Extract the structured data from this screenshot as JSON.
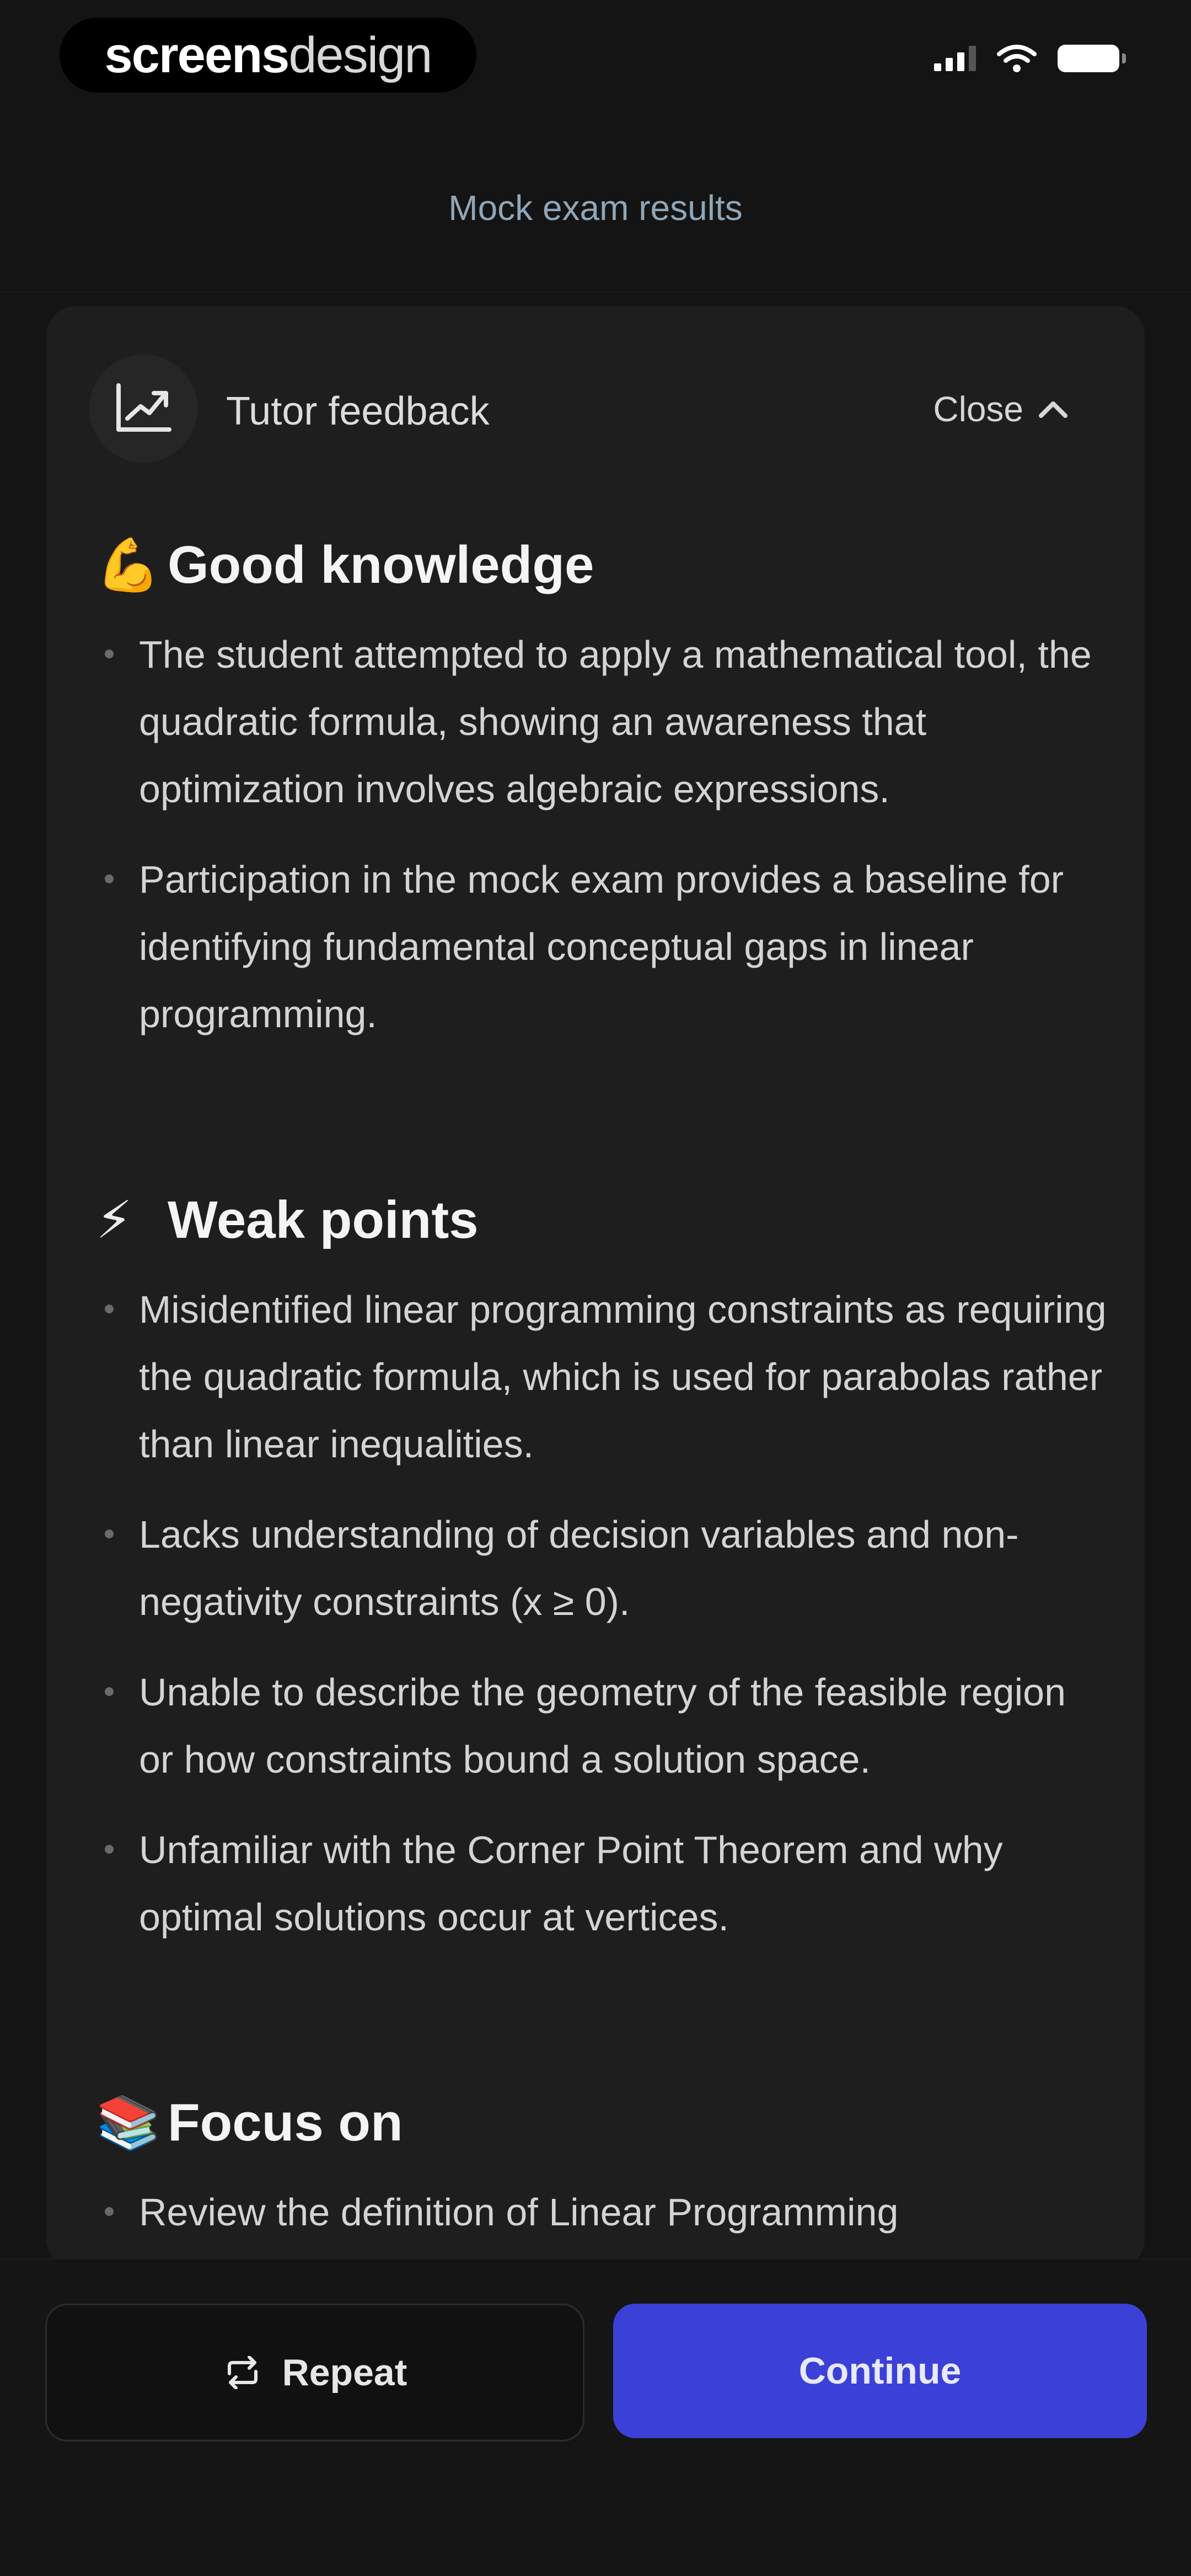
{
  "status_bar": {
    "brand_part1": "screens",
    "brand_part2": "design",
    "icons": [
      "cellular-signal-icon",
      "wifi-icon",
      "battery-icon"
    ]
  },
  "header": {
    "title": "Mock exam results"
  },
  "card": {
    "icon": "chart-icon",
    "title": "Tutor feedback",
    "close_label": "Close",
    "close_icon": "chevron-up-icon"
  },
  "sections": {
    "good": {
      "emoji": "💪",
      "title": "Good knowledge",
      "items": [
        "The student attempted to apply a mathematical tool, the quadratic formula, showing an awareness that optimization involves algebraic expressions.",
        "Participation in the mock exam provides a baseline for identifying fundamental conceptual gaps in linear programming."
      ]
    },
    "weak": {
      "emoji": "⚡",
      "title": "Weak points",
      "items": [
        "Misidentified linear programming constraints as requiring the quadratic formula, which is used for parabolas rather than linear inequalities.",
        "Lacks understanding of decision variables and non-negativity constraints (x ≥ 0).",
        "Unable to describe the geometry of the feasible region or how constraints bound a solution space.",
        "Unfamiliar with the Corner Point Theorem and why optimal solutions occur at vertices."
      ]
    },
    "focus": {
      "emoji": "📚",
      "title": "Focus on",
      "items": [
        "Review the definition of Linear Programming"
      ]
    }
  },
  "actions": {
    "repeat_label": "Repeat",
    "repeat_icon": "repeat-icon",
    "continue_label": "Continue"
  },
  "colors": {
    "background": "#141414",
    "card": "#1e1e1e",
    "accent": "#3b40d6",
    "header_title": "#8fa6b8"
  }
}
